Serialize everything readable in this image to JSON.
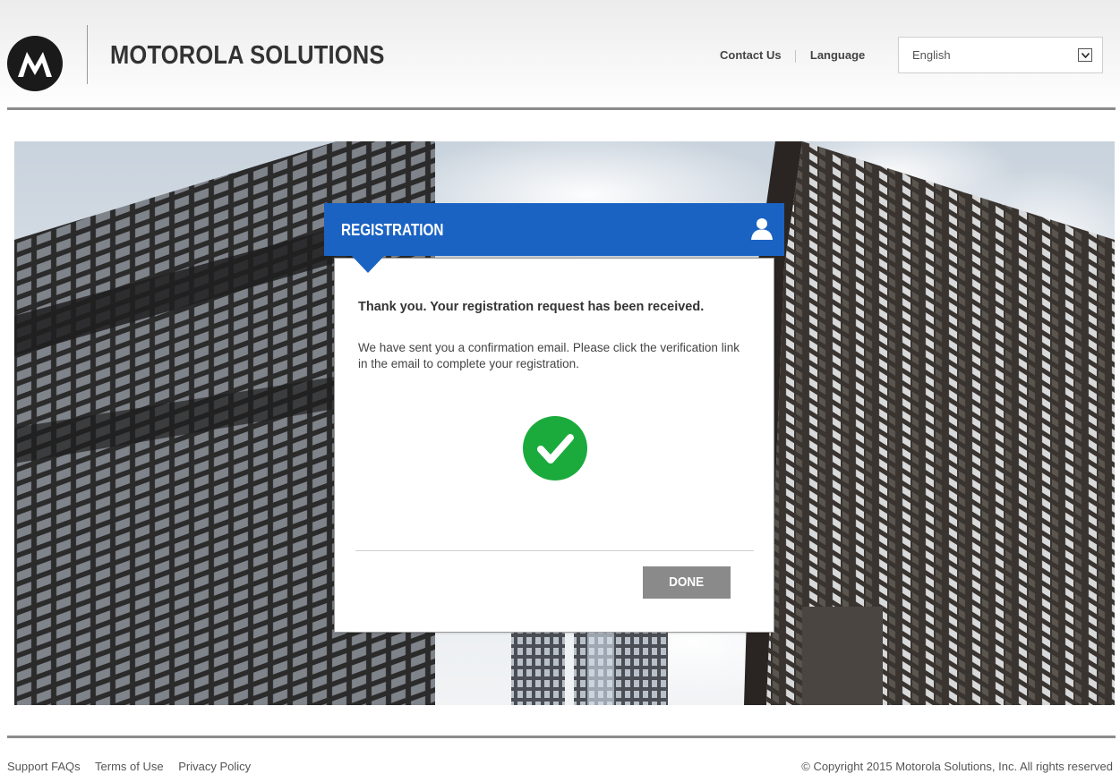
{
  "header": {
    "brand": "MOTOROLA SOLUTIONS",
    "contact_label": "Contact Us",
    "language_label": "Language",
    "language_value": "English",
    "colors": {
      "rule": "#8c8c8c",
      "text": "#333333"
    }
  },
  "hero": {
    "icons": [
      "building-photo"
    ]
  },
  "dialog": {
    "title": "REGISTRATION",
    "heading": "Thank you. Your registration request has been received.",
    "body": "We have sent you a confirmation email. Please click the verification link in the email to complete your registration.",
    "done_label": "DONE",
    "colors": {
      "header": "#1b63c3",
      "check": "#1aab3c",
      "button": "#8a8a8a"
    },
    "icons": [
      "user-icon",
      "checkmark-success-icon"
    ]
  },
  "footer": {
    "links": [
      "Support FAQs",
      "Terms of Use",
      "Privacy Policy"
    ],
    "copyright": "© Copyright 2015 Motorola Solutions, Inc. All rights reserved"
  }
}
